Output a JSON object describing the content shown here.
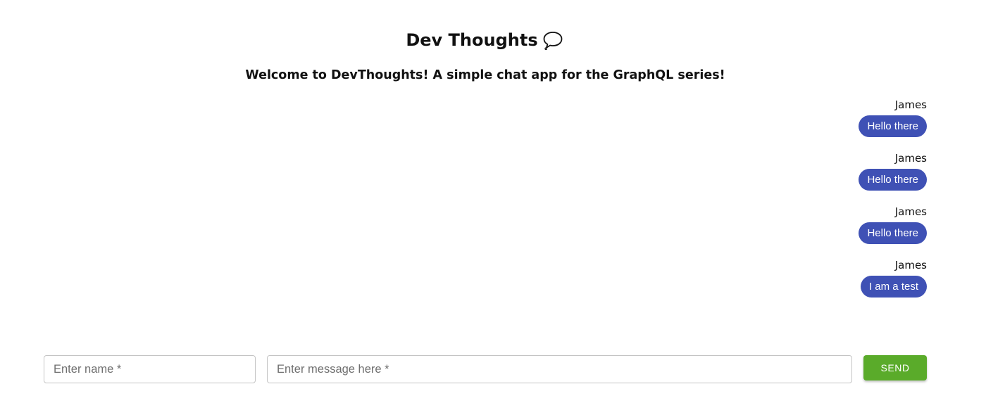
{
  "header": {
    "title": "Dev Thoughts",
    "title_icon": "speech-bubble-icon",
    "subtitle": "Welcome to DevThoughts! A simple chat app for the GraphQL series!"
  },
  "messages": [
    {
      "author": "James",
      "text": "Hello there"
    },
    {
      "author": "James",
      "text": "Hello there"
    },
    {
      "author": "James",
      "text": "Hello there"
    },
    {
      "author": "James",
      "text": "I am a test"
    }
  ],
  "form": {
    "name_input": {
      "value": "",
      "placeholder": "Enter name *"
    },
    "message_input": {
      "value": "",
      "placeholder": "Enter message here *"
    },
    "send_label": "SEND"
  },
  "colors": {
    "bubble": "#3f51b5",
    "send_button": "#5aab2a"
  }
}
